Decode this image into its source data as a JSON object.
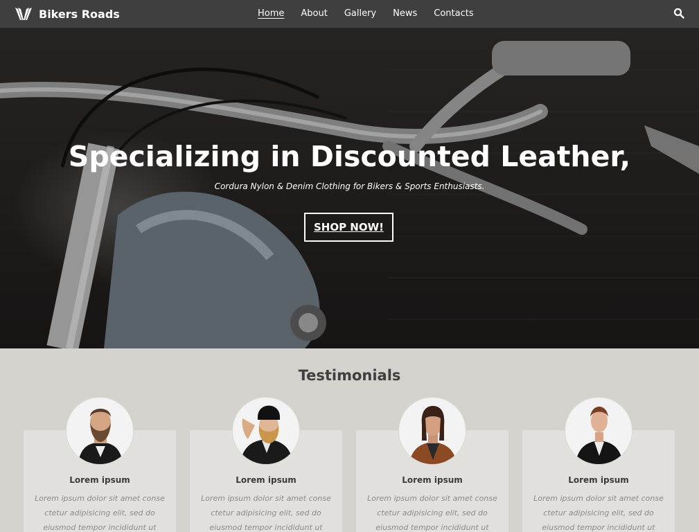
{
  "header": {
    "brand": "Bikers Roads",
    "logo_icon": "wing-logo-icon",
    "nav": [
      {
        "label": "Home",
        "active": true
      },
      {
        "label": "About",
        "active": false
      },
      {
        "label": "Gallery",
        "active": false
      },
      {
        "label": "News",
        "active": false
      },
      {
        "label": "Contacts",
        "active": false
      }
    ],
    "search_icon": "search-icon"
  },
  "hero": {
    "title": "Specializing in Discounted Leather,",
    "subtitle": "Cordura Nylon & Denim Clothing for Bikers & Sports Enthusiasts.",
    "cta_label": "SHOP NOW!"
  },
  "testimonials": {
    "title": "Testimonials",
    "items": [
      {
        "name": "Lorem ipsum",
        "text": "Lorem ipsum dolor sit amet conse ctetur adipisicing elit, sed do eiusmod tempor incididunt ut",
        "avatar": "bearded-man-avatar"
      },
      {
        "name": "Lorem ipsum",
        "text": "Lorem ipsum dolor sit amet conse ctetur adipisicing elit, sed do eiusmod tempor incididunt ut",
        "avatar": "woman-beanie-avatar"
      },
      {
        "name": "Lorem ipsum",
        "text": "Lorem ipsum dolor sit amet conse ctetur adipisicing elit, sed do eiusmod tempor incididunt ut",
        "avatar": "woman-brown-jacket-avatar"
      },
      {
        "name": "Lorem ipsum",
        "text": "Lorem ipsum dolor sit amet conse ctetur adipisicing elit, sed do eiusmod tempor incididunt ut",
        "avatar": "woman-black-jacket-avatar"
      }
    ]
  },
  "colors": {
    "navbar": "#3f3f3f",
    "page_bg": "#d3d2cd",
    "card_bg": "#e1e0dc",
    "title_text": "#3f3f3f",
    "body_text": "#8a8a8a"
  }
}
